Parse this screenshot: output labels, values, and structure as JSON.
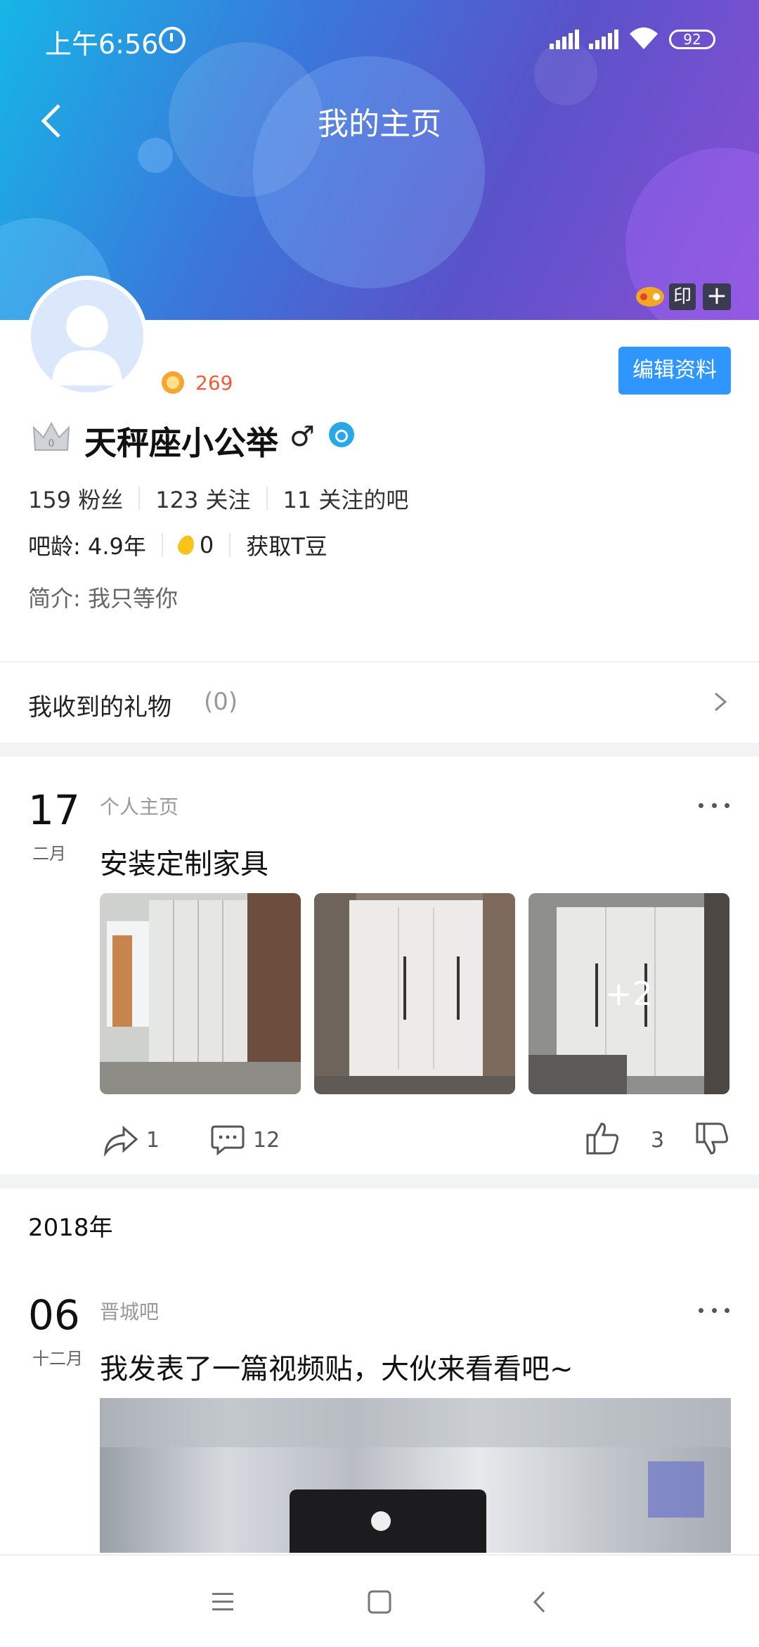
{
  "status": {
    "time": "上午6:56",
    "battery": "92"
  },
  "header": {
    "title": "我的主页"
  },
  "header_badges": {
    "yin": "印",
    "plus": "+"
  },
  "profile": {
    "level": "269",
    "edit_label": "编辑资料",
    "name": "天秤座小公举",
    "gender_symbol": "♂",
    "fans_count": "159",
    "fans_label": "粉丝",
    "following_count": "123",
    "following_label": "关注",
    "bars_count": "11",
    "bars_label": "关注的吧",
    "age": "吧龄: 4.9年",
    "tdou_count": "0",
    "get_tdou": "获取T豆",
    "bio": "简介: 我只等你"
  },
  "gifts": {
    "label": "我收到的礼物",
    "count": "(0)"
  },
  "posts": [
    {
      "day": "17",
      "month": "二月",
      "source": "个人主页",
      "title": "安装定制家具",
      "more_photos": "+2",
      "share_count": "1",
      "comment_count": "12",
      "like_count": "3"
    },
    {
      "day": "06",
      "month": "十二月",
      "source": "晋城吧",
      "title": "我发表了一篇视频贴，大伙来看看吧~"
    }
  ],
  "year_label": "2018年"
}
